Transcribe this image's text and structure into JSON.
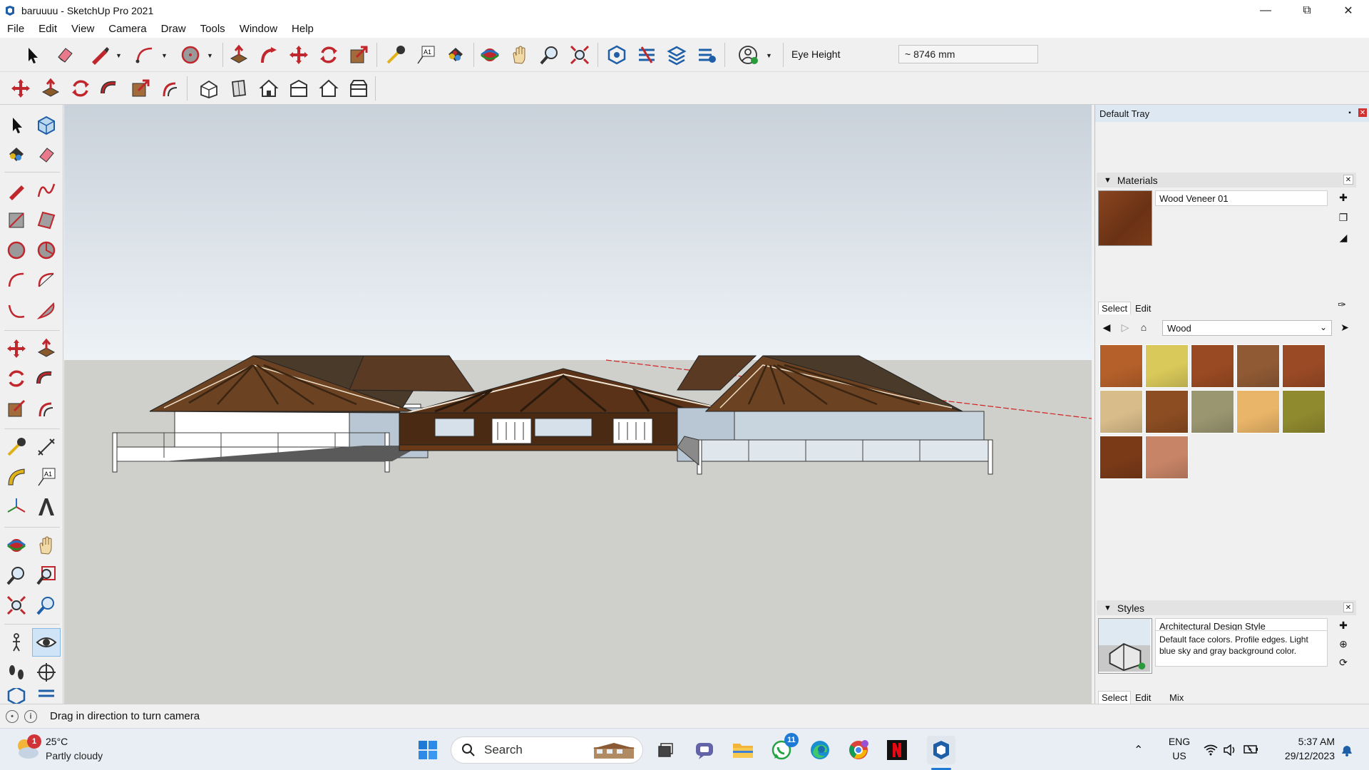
{
  "window": {
    "title": "baruuuu - SketchUp Pro 2021"
  },
  "menu": [
    "File",
    "Edit",
    "View",
    "Camera",
    "Draw",
    "Tools",
    "Window",
    "Help"
  ],
  "toolbar": {
    "eye_height_label": "Eye Height",
    "eye_height_value": "~ 8746 mm"
  },
  "tray": {
    "title": "Default Tray",
    "materials": {
      "header": "Materials",
      "current_name": "Wood Veneer 01",
      "tab_select": "Select",
      "tab_edit": "Edit",
      "library": "Wood",
      "swatch_colors": [
        "#b5602a",
        "#d9c95a",
        "#9a4a22",
        "#8f5a34",
        "#9a4a25",
        "#d8bc8a",
        "#8c4d22",
        "#9a9670",
        "#e9b568",
        "#8f8a2e",
        "#7a3a18",
        "#c88466"
      ]
    },
    "styles": {
      "header": "Styles",
      "name": "Architectural Design Style",
      "description": "Default face colors. Profile edges. Light blue sky and gray background color.",
      "tab_select": "Select",
      "tab_edit": "Edit",
      "tab_mix": "Mix"
    }
  },
  "status": {
    "message": "Drag in direction to turn camera"
  },
  "taskbar": {
    "weather_temp": "25°C",
    "weather_condition": "Partly cloudy",
    "weather_badge": "1",
    "search_label": "Search",
    "whatsapp_badge": "11",
    "lang": "ENG",
    "region": "US",
    "time": "5:37 AM",
    "date": "29/12/2023"
  }
}
